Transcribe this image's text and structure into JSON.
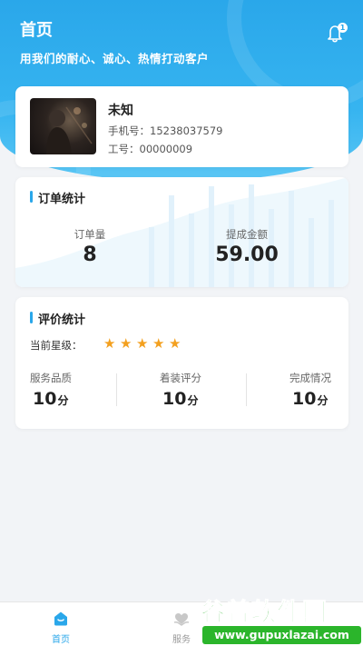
{
  "header": {
    "title": "首页",
    "slogan": "用我们的耐心、诚心、热情打动客户",
    "notification_badge": "1"
  },
  "profile": {
    "name": "未知",
    "phone_label": "手机号：",
    "phone": "15238037579",
    "job_label": "工号：",
    "job_id": "00000009"
  },
  "orders": {
    "title": "订单统计",
    "count_label": "订单量",
    "count_value": "8",
    "amount_label": "提成金额",
    "amount_value": "59.00"
  },
  "ratings": {
    "title": "评价统计",
    "level_label": "当前星级：",
    "stars": 5,
    "metrics": [
      {
        "label": "服务品质",
        "value": "10",
        "unit": "分"
      },
      {
        "label": "着装评分",
        "value": "10",
        "unit": "分"
      },
      {
        "label": "完成情况",
        "value": "10",
        "unit": "分"
      }
    ]
  },
  "tabbar": {
    "tabs": [
      {
        "label": "首页",
        "icon": "home-icon",
        "active": true
      },
      {
        "label": "服务",
        "icon": "service-icon",
        "active": false
      }
    ]
  },
  "watermark": {
    "main": "谷普软件园",
    "url": "www.gupuxlazai.com"
  },
  "colors": {
    "accent": "#2aa7ea",
    "star": "#f3a01f",
    "watermark": "#2bb52b"
  }
}
